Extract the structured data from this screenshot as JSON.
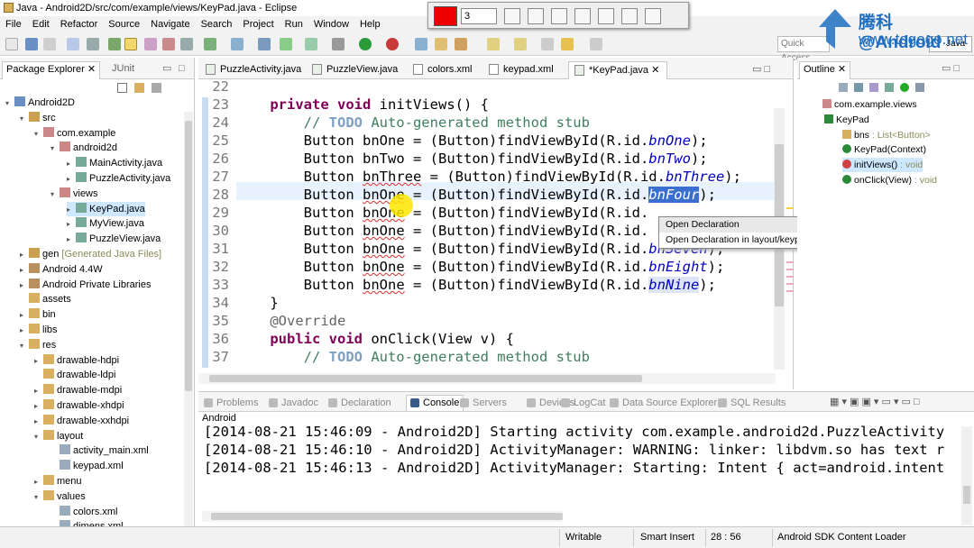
{
  "window": {
    "title": "Java - Android2D/src/com/example/views/KeyPad.java - Eclipse"
  },
  "menu": [
    "File",
    "Edit",
    "Refactor",
    "Source",
    "Navigate",
    "Search",
    "Project",
    "Run",
    "Window",
    "Help"
  ],
  "float_toolbar": {
    "number_value": "3",
    "color": "#ee0000"
  },
  "quick_access": {
    "placeholder": "Quick Access"
  },
  "perspective": {
    "label": "Java"
  },
  "watermark": {
    "line1": "腾科@Android",
    "line2": "www.togogo.net"
  },
  "package_explorer": {
    "tabs": [
      "Package Explorer",
      "JUnit"
    ],
    "items": [
      {
        "label": "Android2D"
      },
      {
        "label": "src"
      },
      {
        "label": "com.example"
      },
      {
        "label": "android2d"
      },
      {
        "label": "MainActivity.java"
      },
      {
        "label": "PuzzleActivity.java"
      },
      {
        "label": "views"
      },
      {
        "label": "KeyPad.java"
      },
      {
        "label": "MyView.java"
      },
      {
        "label": "PuzzleView.java"
      },
      {
        "label": "gen",
        "suffix": "[Generated Java Files]"
      },
      {
        "label": "Android 4.4W"
      },
      {
        "label": "Android Private Libraries"
      },
      {
        "label": "assets"
      },
      {
        "label": "bin"
      },
      {
        "label": "libs"
      },
      {
        "label": "res"
      },
      {
        "label": "drawable-hdpi"
      },
      {
        "label": "drawable-ldpi"
      },
      {
        "label": "drawable-mdpi"
      },
      {
        "label": "drawable-xhdpi"
      },
      {
        "label": "drawable-xxhdpi"
      },
      {
        "label": "layout"
      },
      {
        "label": "activity_main.xml"
      },
      {
        "label": "keypad.xml"
      },
      {
        "label": "menu"
      },
      {
        "label": "values"
      },
      {
        "label": "colors.xml"
      },
      {
        "label": "dimens.xml"
      }
    ]
  },
  "editor": {
    "tabs": [
      "PuzzleActivity.java",
      "PuzzleView.java",
      "colors.xml",
      "keypad.xml",
      "*KeyPad.java"
    ],
    "line_numbers": [
      "22",
      "23",
      "24",
      "25",
      "26",
      "27",
      "28",
      "29",
      "30",
      "31",
      "32",
      "33",
      "34",
      "35",
      "36",
      "37"
    ],
    "code": {
      "l23_kw1": "private",
      "l23_kw2": "void",
      "l23_rest": " initViews() {",
      "todo": "TODO",
      "stub": " Auto-generated method stub",
      "button": "Button",
      "v24": "bnOne",
      "v25": "bnTwo",
      "v26": "bnThree",
      "v27": "bnOne",
      "v28": "bnOne",
      "v29": "bnOne",
      "v30": "bnOne",
      "v31": "bnOne",
      "v32": "bnOne",
      "mid": " = (Button)findViewById(R.id.",
      "f24": "bnOne",
      "f25": "bnTwo",
      "f26": "bnThree",
      "f27": "bnFour",
      "f32": "bnEight",
      "f33": "bnNine",
      "f31": "bnSeven",
      "end": ");",
      "close": "}",
      "override": "@Override",
      "l36_kw1": "public",
      "l36_kw2": "void",
      "l36_rest": " onClick(View v) {"
    },
    "context_menu": [
      "Open Declaration",
      "Open Declaration in layout/keypad.xml"
    ]
  },
  "outline": {
    "title": "Outline",
    "items": [
      {
        "label": "com.example.views"
      },
      {
        "label": "KeyPad"
      },
      {
        "label": "bns",
        "type": " : List<Button>"
      },
      {
        "label": "KeyPad(Context)"
      },
      {
        "label": "initViews()",
        "type": " : void"
      },
      {
        "label": "onClick(View)",
        "type": " : void"
      }
    ]
  },
  "bottom_panel": {
    "tabs": [
      "Problems",
      "Javadoc",
      "Declaration",
      "Console",
      "Servers",
      "Devices",
      "LogCat",
      "Data Source Explorer",
      "SQL Results"
    ],
    "console_title": "Android",
    "lines": [
      "[2014-08-21 15:46:09 - Android2D] Starting activity com.example.android2d.PuzzleActivity",
      "[2014-08-21 15:46:10 - Android2D] ActivityManager: WARNING: linker: libdvm.so has text r",
      "[2014-08-21 15:46:13 - Android2D] ActivityManager: Starting: Intent { act=android.intent"
    ]
  },
  "status": {
    "writable": "Writable",
    "insert": "Smart Insert",
    "position": "28 : 56",
    "loader": "Android SDK Content Loader"
  }
}
